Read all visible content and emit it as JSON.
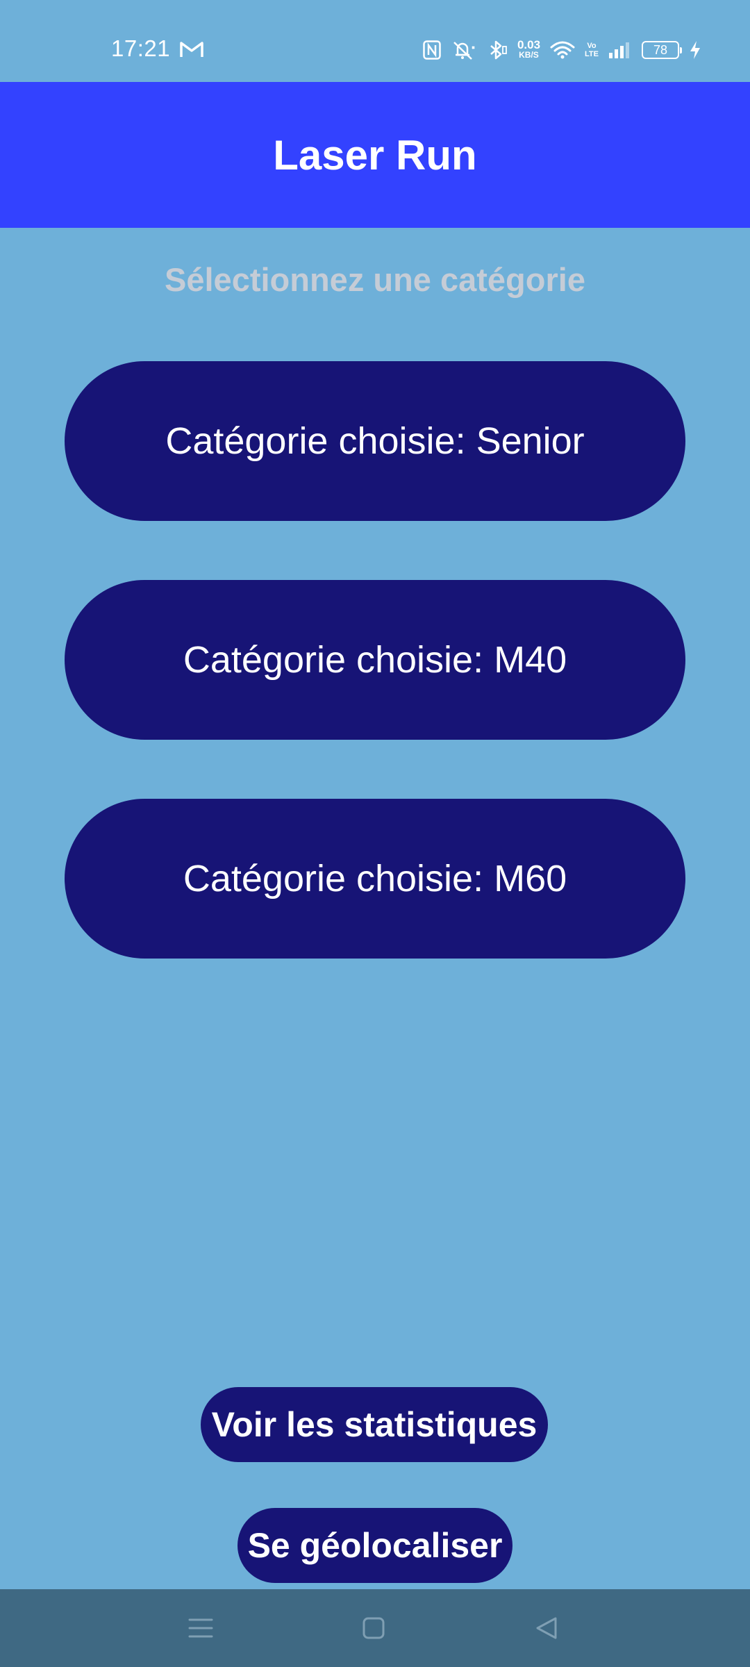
{
  "status_bar": {
    "time": "17:21",
    "net_speed_value": "0.03",
    "net_speed_unit": "KB/S",
    "volte_top": "Vo",
    "volte_bottom": "LTE",
    "battery_level": "78",
    "icons": [
      "gmail-icon",
      "nfc-icon",
      "mute-icon",
      "bluetooth-icon",
      "wifi-icon",
      "signal-icon",
      "battery-icon",
      "charging-icon"
    ]
  },
  "app_bar": {
    "title": "Laser Run"
  },
  "main": {
    "subtitle": "Sélectionnez une catégorie",
    "categories": [
      {
        "label": "Catégorie choisie: Senior"
      },
      {
        "label": "Catégorie choisie: M40"
      },
      {
        "label": "Catégorie choisie: M60"
      }
    ],
    "stats_button": "Voir les statistiques",
    "geo_button": "Se géolocaliser"
  },
  "nav_bar": {
    "icons": [
      "menu-icon",
      "home-icon",
      "back-icon"
    ]
  },
  "colors": {
    "background": "#6eb0d9",
    "app_bar": "#3342ff",
    "button": "#171476",
    "subtitle": "#c5ccd6",
    "nav_bar": "#3f6983"
  }
}
